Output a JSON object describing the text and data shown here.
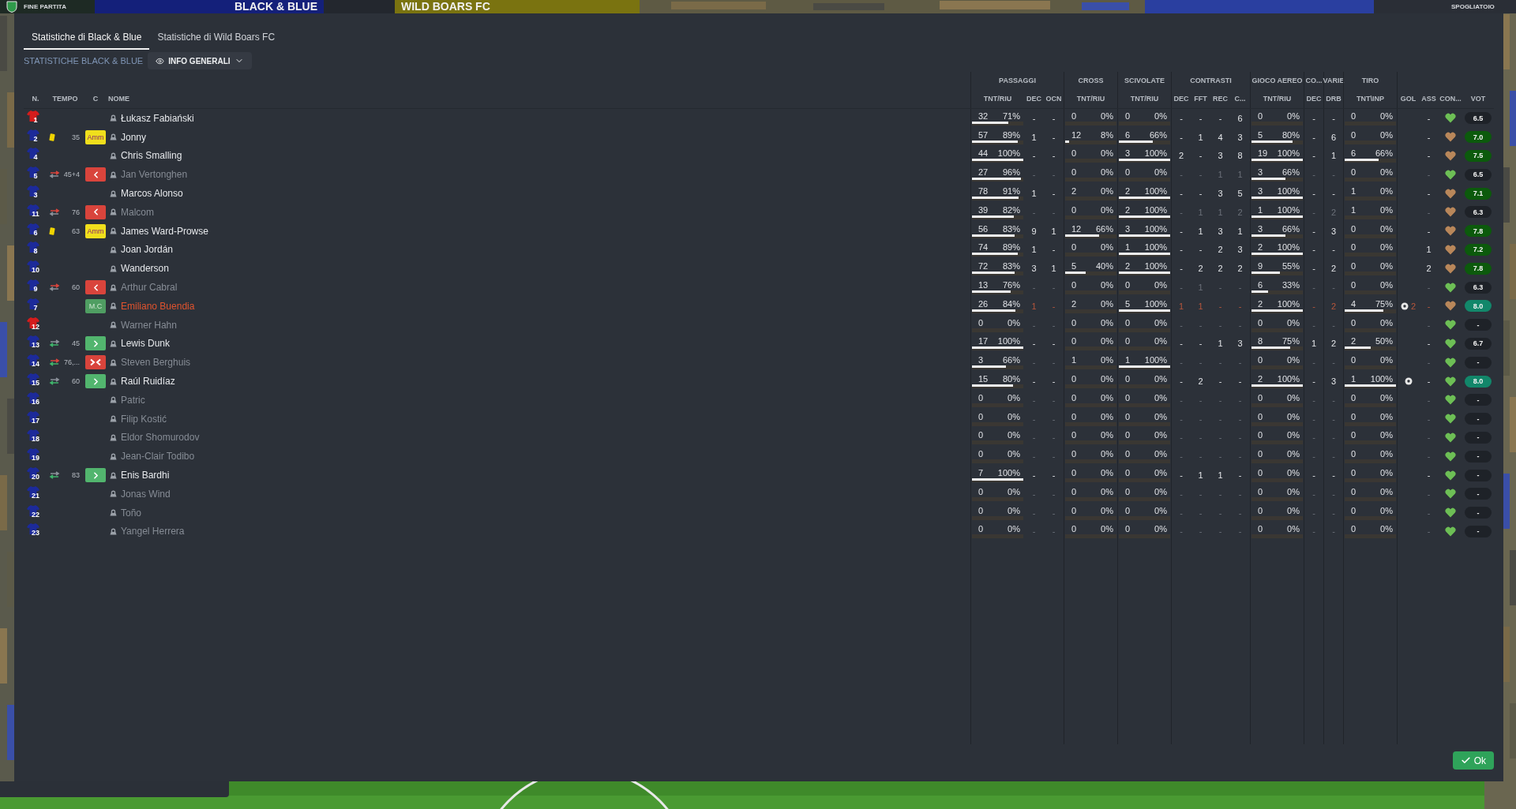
{
  "top_bar": {
    "status": "FINE PARTITA",
    "home_team": "BLACK & BLUE",
    "away_team": "WILD BOARS FC",
    "menu": "SPOGLIATOIO"
  },
  "tabs": [
    {
      "label": "Statistiche di Black & Blue",
      "selected": true
    },
    {
      "label": "Statistiche di Wild Boars FC",
      "selected": false
    }
  ],
  "section_title": "STATISTICHE BLACK & BLUE",
  "view_dropdown": {
    "label": "INFO GENERALI"
  },
  "table": {
    "left_columns": [
      "N.",
      "TEMPO",
      "C",
      "NOME"
    ],
    "column_groups": [
      {
        "label": "PASSAGGI",
        "columns": [
          {
            "label": "TNT/RIU",
            "kind": "bar"
          },
          {
            "label": "DEC",
            "kind": "count"
          },
          {
            "label": "OCN",
            "kind": "count"
          }
        ]
      },
      {
        "label": "CROSS",
        "columns": [
          {
            "label": "TNT/RIU",
            "kind": "bar"
          }
        ]
      },
      {
        "label": "SCIVOLATE",
        "columns": [
          {
            "label": "TNT/RIU",
            "kind": "bar"
          }
        ]
      },
      {
        "label": "CONTRASTI",
        "columns": [
          {
            "label": "DEC",
            "kind": "count"
          },
          {
            "label": "FFT",
            "kind": "count"
          },
          {
            "label": "REC",
            "kind": "count"
          },
          {
            "label": "C...",
            "kind": "count"
          }
        ]
      },
      {
        "label": "GIOCO AEREO",
        "columns": [
          {
            "label": "TNT/RIU",
            "kind": "bar"
          }
        ]
      },
      {
        "label": "CO...",
        "columns": [
          {
            "label": "DEC",
            "kind": "count"
          }
        ]
      },
      {
        "label": "VARIE",
        "columns": [
          {
            "label": "DRB",
            "kind": "count"
          }
        ]
      },
      {
        "label": "TIRO",
        "columns": [
          {
            "label": "TNT\\INP",
            "kind": "bar"
          }
        ]
      },
      {
        "columns": [
          {
            "label": "GOL",
            "kind": "goal"
          },
          {
            "label": "ASS",
            "kind": "count"
          },
          {
            "label": "CON...",
            "kind": "condition"
          },
          {
            "label": "VOT",
            "kind": "rating"
          }
        ]
      }
    ],
    "rows": [
      {
        "kit": {
          "number": "1",
          "color": "#d41c1c"
        },
        "name": "Łukasz Fabiański",
        "kind": "played",
        "cells": [
          {
            "count": "32",
            "pct": "71%",
            "level": 0.71
          },
          "-",
          "-",
          {
            "count": "0",
            "pct": "0%"
          },
          {
            "count": "0",
            "pct": "0%"
          },
          "-",
          "-",
          "-",
          "6",
          {
            "count": "0",
            "pct": "0%"
          },
          "-",
          "-",
          {
            "count": "0",
            "pct": "0%"
          },
          {
            "scored": false
          },
          "-",
          {
            "color": "#6dbf55"
          },
          {
            "value": "6.5",
            "kind": "plain"
          }
        ]
      },
      {
        "kit": {
          "number": "2",
          "color": "#1c2a9a"
        },
        "event": {
          "kind": "card",
          "minute": "35"
        },
        "badge": {
          "kind": "booked",
          "label": "Amm"
        },
        "name": "Jonny",
        "kind": "played",
        "cells": [
          {
            "count": "57",
            "pct": "89%",
            "level": 0.89
          },
          "1",
          "-",
          {
            "count": "12",
            "pct": "8%",
            "level": 0.08
          },
          {
            "count": "6",
            "pct": "66%",
            "level": 0.66
          },
          "-",
          "1",
          "4",
          "3",
          {
            "count": "5",
            "pct": "80%",
            "level": 0.8
          },
          "-",
          "6",
          {
            "count": "0",
            "pct": "0%"
          },
          {
            "scored": false
          },
          "-",
          {
            "color": "#b9875a"
          },
          {
            "value": "7.0",
            "kind": "good"
          }
        ]
      },
      {
        "kit": {
          "number": "4",
          "color": "#1c2a9a"
        },
        "name": "Chris Smalling",
        "kind": "played",
        "cells": [
          {
            "count": "44",
            "pct": "100%",
            "level": 1
          },
          "-",
          "-",
          {
            "count": "0",
            "pct": "0%"
          },
          {
            "count": "3",
            "pct": "100%",
            "level": 1
          },
          "2",
          "-",
          "3",
          "8",
          {
            "count": "19",
            "pct": "100%",
            "level": 1
          },
          "-",
          "1",
          {
            "count": "6",
            "pct": "66%",
            "level": 0.66
          },
          {
            "scored": false
          },
          "-",
          {
            "color": "#b9875a"
          },
          {
            "value": "7.5",
            "kind": "good"
          }
        ]
      },
      {
        "kit": {
          "number": "5",
          "color": "#1c2a9a"
        },
        "event": {
          "kind": "sub_off",
          "minute": "45+4"
        },
        "badge": {
          "kind": "off"
        },
        "name": "Jan Vertonghen",
        "kind": "off",
        "cells": [
          {
            "count": "27",
            "pct": "96%",
            "level": 0.96
          },
          "-",
          "-",
          {
            "count": "0",
            "pct": "0%"
          },
          {
            "count": "0",
            "pct": "0%"
          },
          "-",
          "-",
          "1",
          "1",
          {
            "count": "3",
            "pct": "66%",
            "level": 0.66
          },
          "-",
          "-",
          {
            "count": "0",
            "pct": "0%"
          },
          {
            "scored": false
          },
          "-",
          {
            "color": "#6dbf55"
          },
          {
            "value": "6.5",
            "kind": "plain"
          }
        ]
      },
      {
        "kit": {
          "number": "3",
          "color": "#1c2a9a"
        },
        "name": "Marcos Alonso",
        "kind": "played",
        "cells": [
          {
            "count": "78",
            "pct": "91%",
            "level": 0.91
          },
          "1",
          "-",
          {
            "count": "2",
            "pct": "0%"
          },
          {
            "count": "2",
            "pct": "100%",
            "level": 1
          },
          "-",
          "-",
          "3",
          "5",
          {
            "count": "3",
            "pct": "100%",
            "level": 1
          },
          "-",
          "-",
          {
            "count": "1",
            "pct": "0%"
          },
          {
            "scored": false
          },
          "-",
          {
            "color": "#b9875a"
          },
          {
            "value": "7.1",
            "kind": "good"
          }
        ]
      },
      {
        "kit": {
          "number": "11",
          "color": "#1c2a9a"
        },
        "event": {
          "kind": "sub_off",
          "minute": "76"
        },
        "badge": {
          "kind": "off"
        },
        "name": "Malcom",
        "kind": "off",
        "cells": [
          {
            "count": "39",
            "pct": "82%",
            "level": 0.82
          },
          "-",
          "-",
          {
            "count": "0",
            "pct": "0%"
          },
          {
            "count": "2",
            "pct": "100%",
            "level": 1
          },
          "-",
          "1",
          "1",
          "2",
          {
            "count": "1",
            "pct": "100%",
            "level": 1
          },
          "-",
          "2",
          {
            "count": "1",
            "pct": "0%"
          },
          {
            "scored": false
          },
          "-",
          {
            "color": "#b9875a"
          },
          {
            "value": "6.3",
            "kind": "plain"
          }
        ]
      },
      {
        "kit": {
          "number": "6",
          "color": "#1c2a9a"
        },
        "event": {
          "kind": "card",
          "minute": "63"
        },
        "badge": {
          "kind": "booked",
          "label": "Amm"
        },
        "name": "James Ward-Prowse",
        "kind": "played",
        "cells": [
          {
            "count": "56",
            "pct": "83%",
            "level": 0.83
          },
          "9",
          "1",
          {
            "count": "12",
            "pct": "66%",
            "level": 0.66
          },
          {
            "count": "3",
            "pct": "100%",
            "level": 1
          },
          "-",
          "1",
          "3",
          "1",
          {
            "count": "3",
            "pct": "66%",
            "level": 0.66
          },
          "-",
          "3",
          {
            "count": "0",
            "pct": "0%"
          },
          {
            "scored": false
          },
          "-",
          {
            "color": "#b9875a"
          },
          {
            "value": "7.8",
            "kind": "good"
          }
        ]
      },
      {
        "kit": {
          "number": "8",
          "color": "#1c2a9a"
        },
        "name": "Joan Jordán",
        "kind": "played",
        "cells": [
          {
            "count": "74",
            "pct": "89%",
            "level": 0.89
          },
          "1",
          "-",
          {
            "count": "0",
            "pct": "0%"
          },
          {
            "count": "1",
            "pct": "100%",
            "level": 1
          },
          "-",
          "-",
          "2",
          "3",
          {
            "count": "2",
            "pct": "100%",
            "level": 1
          },
          "-",
          "-",
          {
            "count": "0",
            "pct": "0%"
          },
          {
            "scored": false
          },
          "1",
          {
            "color": "#b9875a"
          },
          {
            "value": "7.2",
            "kind": "good"
          }
        ]
      },
      {
        "kit": {
          "number": "10",
          "color": "#1c2a9a"
        },
        "name": "Wanderson",
        "kind": "played",
        "cells": [
          {
            "count": "72",
            "pct": "83%",
            "level": 0.83
          },
          "3",
          "1",
          {
            "count": "5",
            "pct": "40%",
            "level": 0.4
          },
          {
            "count": "2",
            "pct": "100%",
            "level": 1
          },
          "-",
          "2",
          "2",
          "2",
          {
            "count": "9",
            "pct": "55%",
            "level": 0.55
          },
          "-",
          "2",
          {
            "count": "0",
            "pct": "0%"
          },
          {
            "scored": false
          },
          "2",
          {
            "color": "#b9875a"
          },
          {
            "value": "7.8",
            "kind": "good"
          }
        ]
      },
      {
        "kit": {
          "number": "9",
          "color": "#1c2a9a"
        },
        "event": {
          "kind": "sub_off",
          "minute": "60"
        },
        "badge": {
          "kind": "off"
        },
        "name": "Arthur Cabral",
        "kind": "off",
        "cells": [
          {
            "count": "13",
            "pct": "76%",
            "level": 0.76
          },
          "-",
          "-",
          {
            "count": "0",
            "pct": "0%"
          },
          {
            "count": "0",
            "pct": "0%"
          },
          "-",
          "1",
          "-",
          "-",
          {
            "count": "6",
            "pct": "33%",
            "level": 0.33
          },
          "-",
          "-",
          {
            "count": "0",
            "pct": "0%"
          },
          {
            "scored": false
          },
          "-",
          {
            "color": "#6dbf55"
          },
          {
            "value": "6.3",
            "kind": "plain"
          }
        ]
      },
      {
        "kit": {
          "number": "7",
          "color": "#1c2a9a"
        },
        "badge": {
          "kind": "motm",
          "label": "M.C"
        },
        "name": "Emiliano Buendia",
        "kind": "star",
        "cells": [
          {
            "count": "26",
            "pct": "84%",
            "level": 0.84
          },
          "1",
          "-",
          {
            "count": "2",
            "pct": "0%"
          },
          {
            "count": "5",
            "pct": "100%",
            "level": 1
          },
          "1",
          "1",
          "-",
          "-",
          {
            "count": "2",
            "pct": "100%",
            "level": 1
          },
          "-",
          "2",
          {
            "count": "4",
            "pct": "75%",
            "level": 0.75
          },
          {
            "scored": true,
            "count": "2"
          },
          "-",
          {
            "color": "#b9875a"
          },
          {
            "value": "8.0",
            "kind": "best"
          }
        ]
      },
      {
        "kit": {
          "number": "12",
          "color": "#d41c1c"
        },
        "name": "Warner Hahn",
        "kind": "off",
        "cells": [
          {
            "count": "0",
            "pct": "0%"
          },
          "-",
          "-",
          {
            "count": "0",
            "pct": "0%"
          },
          {
            "count": "0",
            "pct": "0%"
          },
          "-",
          "-",
          "-",
          "-",
          {
            "count": "0",
            "pct": "0%"
          },
          "-",
          "-",
          {
            "count": "0",
            "pct": "0%"
          },
          {
            "scored": false
          },
          "-",
          {
            "color": "#6dbf55"
          },
          {
            "value": "-",
            "kind": "plain"
          }
        ]
      },
      {
        "kit": {
          "number": "13",
          "color": "#1c2a9a"
        },
        "event": {
          "kind": "sub_on",
          "minute": "45"
        },
        "badge": {
          "kind": "on"
        },
        "name": "Lewis Dunk",
        "kind": "played",
        "cells": [
          {
            "count": "17",
            "pct": "100%",
            "level": 1
          },
          "-",
          "-",
          {
            "count": "0",
            "pct": "0%"
          },
          {
            "count": "0",
            "pct": "0%"
          },
          "-",
          "-",
          "1",
          "3",
          {
            "count": "8",
            "pct": "75%",
            "level": 0.75
          },
          "1",
          "2",
          {
            "count": "2",
            "pct": "50%",
            "level": 0.5
          },
          {
            "scored": false
          },
          "-",
          {
            "color": "#6dbf55"
          },
          {
            "value": "6.7",
            "kind": "plain"
          }
        ]
      },
      {
        "kit": {
          "number": "14",
          "color": "#1c2a9a"
        },
        "event": {
          "kind": "sub_on_off",
          "minute": "76,..."
        },
        "badge": {
          "kind": "on_off"
        },
        "name": "Steven Berghuis",
        "kind": "off",
        "cells": [
          {
            "count": "3",
            "pct": "66%",
            "level": 0.66
          },
          "-",
          "-",
          {
            "count": "1",
            "pct": "0%"
          },
          {
            "count": "1",
            "pct": "100%",
            "level": 1
          },
          "-",
          "-",
          "-",
          "-",
          {
            "count": "0",
            "pct": "0%"
          },
          "-",
          "-",
          {
            "count": "0",
            "pct": "0%"
          },
          {
            "scored": false
          },
          "-",
          {
            "color": "#6dbf55"
          },
          {
            "value": "-",
            "kind": "plain"
          }
        ]
      },
      {
        "kit": {
          "number": "15",
          "color": "#1c2a9a"
        },
        "event": {
          "kind": "sub_on",
          "minute": "60"
        },
        "badge": {
          "kind": "on"
        },
        "name": "Raúl Ruidíaz",
        "kind": "played",
        "cells": [
          {
            "count": "15",
            "pct": "80%",
            "level": 0.8
          },
          "-",
          "-",
          {
            "count": "0",
            "pct": "0%"
          },
          {
            "count": "0",
            "pct": "0%"
          },
          "-",
          "2",
          "-",
          "-",
          {
            "count": "2",
            "pct": "100%",
            "level": 1
          },
          "-",
          "3",
          {
            "count": "1",
            "pct": "100%",
            "level": 1
          },
          {
            "scored": true
          },
          "-",
          {
            "color": "#6dbf55"
          },
          {
            "value": "8.0",
            "kind": "best"
          }
        ]
      },
      {
        "kit": {
          "number": "16",
          "color": "#1c2a9a"
        },
        "name": "Patric",
        "kind": "off",
        "cells": [
          {
            "count": "0",
            "pct": "0%"
          },
          "-",
          "-",
          {
            "count": "0",
            "pct": "0%"
          },
          {
            "count": "0",
            "pct": "0%"
          },
          "-",
          "-",
          "-",
          "-",
          {
            "count": "0",
            "pct": "0%"
          },
          "-",
          "-",
          {
            "count": "0",
            "pct": "0%"
          },
          {
            "scored": false
          },
          "-",
          {
            "color": "#6dbf55"
          },
          {
            "value": "-",
            "kind": "plain"
          }
        ]
      },
      {
        "kit": {
          "number": "17",
          "color": "#1c2a9a"
        },
        "name": "Filip Kostić",
        "kind": "off",
        "cells": [
          {
            "count": "0",
            "pct": "0%"
          },
          "-",
          "-",
          {
            "count": "0",
            "pct": "0%"
          },
          {
            "count": "0",
            "pct": "0%"
          },
          "-",
          "-",
          "-",
          "-",
          {
            "count": "0",
            "pct": "0%"
          },
          "-",
          "-",
          {
            "count": "0",
            "pct": "0%"
          },
          {
            "scored": false
          },
          "-",
          {
            "color": "#6dbf55"
          },
          {
            "value": "-",
            "kind": "plain"
          }
        ]
      },
      {
        "kit": {
          "number": "18",
          "color": "#1c2a9a"
        },
        "name": "Eldor Shomurodov",
        "kind": "off",
        "cells": [
          {
            "count": "0",
            "pct": "0%"
          },
          "-",
          "-",
          {
            "count": "0",
            "pct": "0%"
          },
          {
            "count": "0",
            "pct": "0%"
          },
          "-",
          "-",
          "-",
          "-",
          {
            "count": "0",
            "pct": "0%"
          },
          "-",
          "-",
          {
            "count": "0",
            "pct": "0%"
          },
          {
            "scored": false
          },
          "-",
          {
            "color": "#6dbf55"
          },
          {
            "value": "-",
            "kind": "plain"
          }
        ]
      },
      {
        "kit": {
          "number": "19",
          "color": "#1c2a9a"
        },
        "name": "Jean-Clair Todibo",
        "kind": "off",
        "cells": [
          {
            "count": "0",
            "pct": "0%"
          },
          "-",
          "-",
          {
            "count": "0",
            "pct": "0%"
          },
          {
            "count": "0",
            "pct": "0%"
          },
          "-",
          "-",
          "-",
          "-",
          {
            "count": "0",
            "pct": "0%"
          },
          "-",
          "-",
          {
            "count": "0",
            "pct": "0%"
          },
          {
            "scored": false
          },
          "-",
          {
            "color": "#6dbf55"
          },
          {
            "value": "-",
            "kind": "plain"
          }
        ]
      },
      {
        "kit": {
          "number": "20",
          "color": "#1c2a9a"
        },
        "event": {
          "kind": "sub_on",
          "minute": "83"
        },
        "badge": {
          "kind": "on"
        },
        "name": "Enis Bardhi",
        "kind": "played",
        "cells": [
          {
            "count": "7",
            "pct": "100%",
            "level": 1
          },
          "-",
          "-",
          {
            "count": "0",
            "pct": "0%"
          },
          {
            "count": "0",
            "pct": "0%"
          },
          "-",
          "1",
          "1",
          "-",
          {
            "count": "0",
            "pct": "0%"
          },
          "-",
          "-",
          {
            "count": "0",
            "pct": "0%"
          },
          {
            "scored": false
          },
          "-",
          {
            "color": "#6dbf55"
          },
          {
            "value": "-",
            "kind": "plain"
          }
        ]
      },
      {
        "kit": {
          "number": "21",
          "color": "#1c2a9a"
        },
        "name": "Jonas Wind",
        "kind": "off",
        "cells": [
          {
            "count": "0",
            "pct": "0%"
          },
          "-",
          "-",
          {
            "count": "0",
            "pct": "0%"
          },
          {
            "count": "0",
            "pct": "0%"
          },
          "-",
          "-",
          "-",
          "-",
          {
            "count": "0",
            "pct": "0%"
          },
          "-",
          "-",
          {
            "count": "0",
            "pct": "0%"
          },
          {
            "scored": false
          },
          "-",
          {
            "color": "#6dbf55"
          },
          {
            "value": "-",
            "kind": "plain"
          }
        ]
      },
      {
        "kit": {
          "number": "22",
          "color": "#1c2a9a"
        },
        "name": "Toño",
        "kind": "off",
        "cells": [
          {
            "count": "0",
            "pct": "0%"
          },
          "-",
          "-",
          {
            "count": "0",
            "pct": "0%"
          },
          {
            "count": "0",
            "pct": "0%"
          },
          "-",
          "-",
          "-",
          "-",
          {
            "count": "0",
            "pct": "0%"
          },
          "-",
          "-",
          {
            "count": "0",
            "pct": "0%"
          },
          {
            "scored": false
          },
          "-",
          {
            "color": "#6dbf55"
          },
          {
            "value": "-",
            "kind": "plain"
          }
        ]
      },
      {
        "kit": {
          "number": "23",
          "color": "#1c2a9a"
        },
        "name": "Yangel Herrera",
        "kind": "off",
        "cells": [
          {
            "count": "0",
            "pct": "0%"
          },
          "-",
          "-",
          {
            "count": "0",
            "pct": "0%"
          },
          {
            "count": "0",
            "pct": "0%"
          },
          "-",
          "-",
          "-",
          "-",
          {
            "count": "0",
            "pct": "0%"
          },
          "-",
          "-",
          {
            "count": "0",
            "pct": "0%"
          },
          {
            "scored": false
          },
          "-",
          {
            "color": "#6dbf55"
          },
          {
            "value": "-",
            "kind": "plain"
          }
        ]
      }
    ]
  },
  "ok_button": {
    "label": "Ok"
  }
}
